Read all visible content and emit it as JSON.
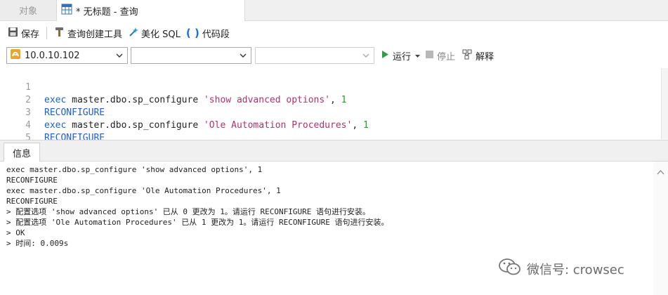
{
  "tabs": {
    "objects_label": "对象",
    "query_label": "* 无标题 - 查询"
  },
  "toolbar": {
    "save_label": "保存",
    "query_builder_label": "查询创建工具",
    "beautify_label": "美化 SQL",
    "snippet_label": "代码段"
  },
  "connection": {
    "server": "10.0.10.102",
    "database": "",
    "schema": ""
  },
  "run": {
    "run_label": "运行",
    "stop_label": "停止",
    "explain_label": "解释"
  },
  "editor": {
    "line_numbers": [
      "1",
      "2",
      "3",
      "4",
      "5"
    ],
    "lines": [
      {
        "kw": "exec",
        "plain": " master.dbo.sp_configure ",
        "str": "'show advanced options'",
        "sep": ", ",
        "num": "1"
      },
      {
        "kw": "RECONFIGURE"
      },
      {
        "kw": "exec",
        "plain": " master.dbo.sp_configure ",
        "str": "'Ole Automation Procedures'",
        "sep": ", ",
        "num": "1"
      },
      {
        "kw": "RECONFIGURE"
      },
      {}
    ]
  },
  "panel": {
    "info_tab_label": "信息"
  },
  "output": {
    "lines": [
      "exec master.dbo.sp_configure 'show advanced options', 1",
      "RECONFIGURE",
      "exec master.dbo.sp_configure 'Ole Automation Procedures', 1",
      "RECONFIGURE",
      "> 配置选项 'show advanced options' 已从 0 更改为 1。请运行 RECONFIGURE 语句进行安装。",
      "> 配置选项 'Ole Automation Procedures' 已从 1 更改为 1。请运行 RECONFIGURE 语句进行安装。",
      "> OK",
      "> 时间: 0.009s"
    ]
  },
  "watermark": {
    "text": "微信号: crowsec"
  },
  "colors": {
    "keyword": "#1a5fd6",
    "string": "#b5306a",
    "number": "#23a023",
    "run_green": "#2ea043"
  }
}
